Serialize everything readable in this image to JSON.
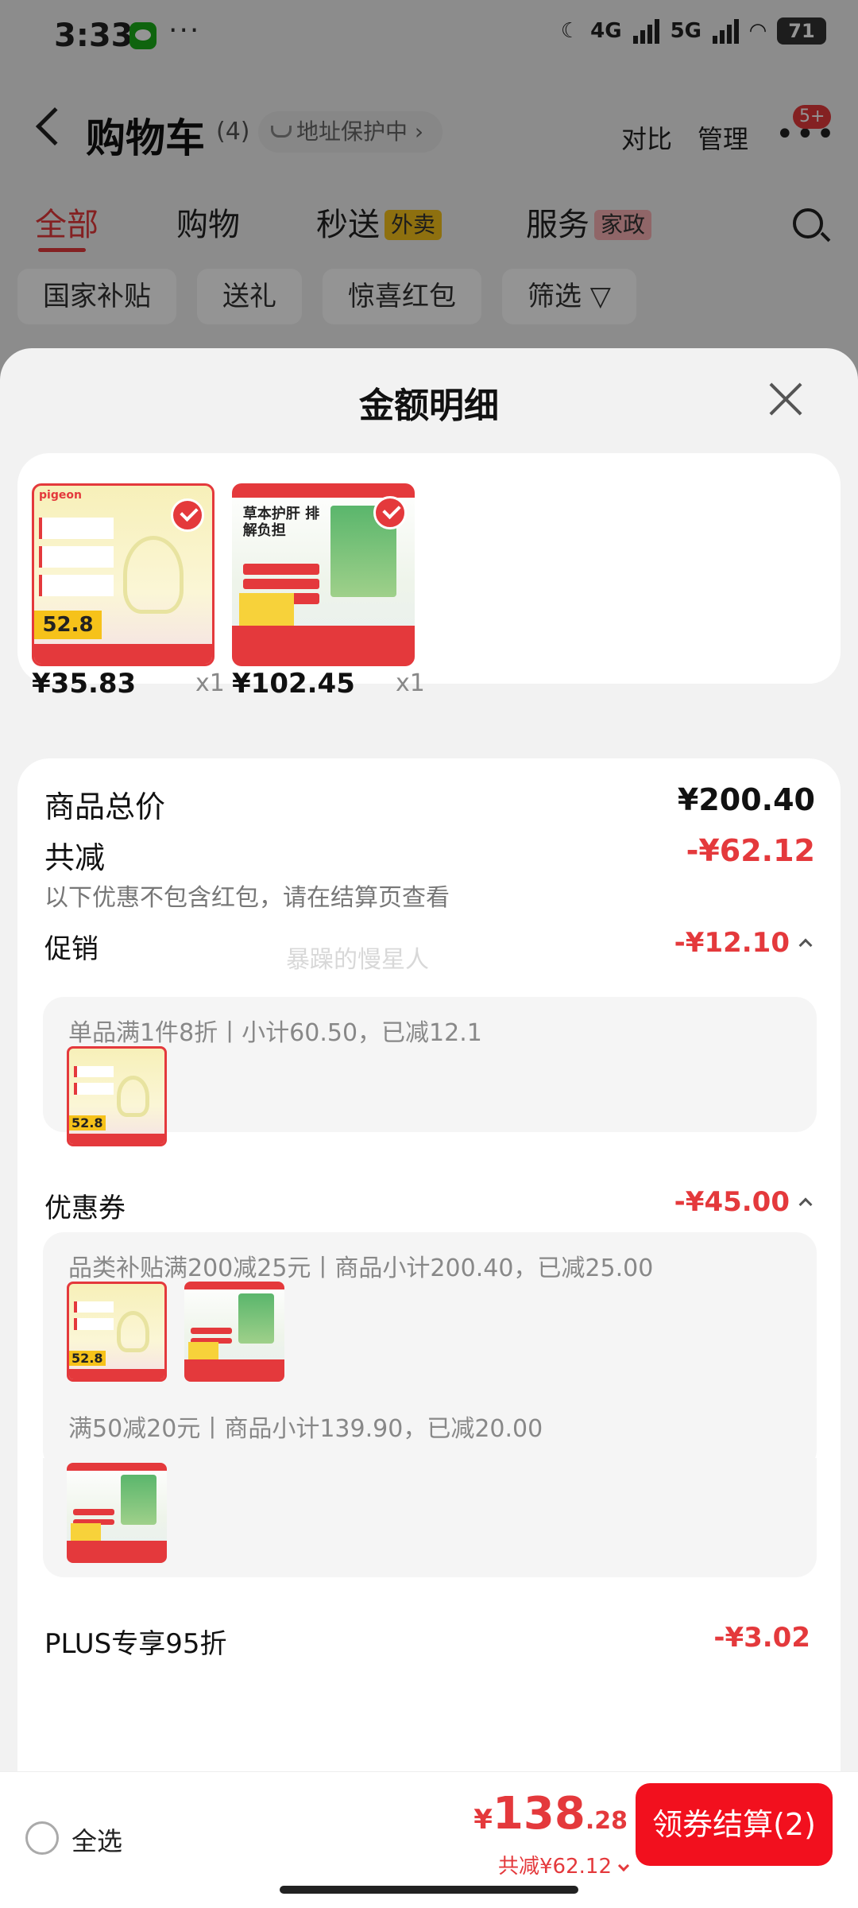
{
  "status_bar": {
    "time": "3:33",
    "dots": "···",
    "net1": "4G",
    "net2": "5G",
    "battery": "71"
  },
  "cart_header": {
    "title": "购物车",
    "count": "(4)",
    "address_pill": "地址保护中 ›",
    "compare": "对比",
    "manage": "管理",
    "more_badge": "5+"
  },
  "tabs": [
    {
      "label": "全部",
      "tag": ""
    },
    {
      "label": "购物",
      "tag": ""
    },
    {
      "label": "秒送",
      "tag": "外卖"
    },
    {
      "label": "服务",
      "tag": "家政"
    }
  ],
  "filters": [
    "国家补贴",
    "送礼",
    "惊喜红包",
    "筛选 ▽"
  ],
  "sheet": {
    "title": "金额明细",
    "products": [
      {
        "price": "¥35.83",
        "qty": "x1",
        "thumb_text": "52.8",
        "brand": "pigeon"
      },
      {
        "price": "¥102.45",
        "qty": "x1",
        "thumb_text": "草本护肝 排解负担"
      }
    ],
    "total_label": "商品总价",
    "total_value": "¥200.40",
    "discount_label": "共减",
    "discount_value": "-¥62.12",
    "discount_note": "以下优惠不包含红包，请在结算页查看",
    "watermark": "暴躁的慢星人",
    "promo": {
      "label": "促销",
      "value": "-¥12.10",
      "line1": "单品满1件8折丨小计60.50，已减12.1"
    },
    "coupon": {
      "label": "优惠券",
      "value": "-¥45.00",
      "line1": "品类补贴满200减25元丨商品小计200.40，已减25.00",
      "line2": "满50减20元丨商品小计139.90，已减20.00"
    },
    "plus": {
      "label": "PLUS专享95折",
      "value": "-¥3.02"
    }
  },
  "bottom_bar": {
    "select_all": "全选",
    "yen": "¥",
    "total_int": "138",
    "total_dec": ".28",
    "saved": "共减¥62.12",
    "checkout": "领券结算(2)"
  },
  "colors": {
    "accent": "#e4393c",
    "checkout": "#f2101e",
    "yellow_tag": "#f5c21b"
  }
}
